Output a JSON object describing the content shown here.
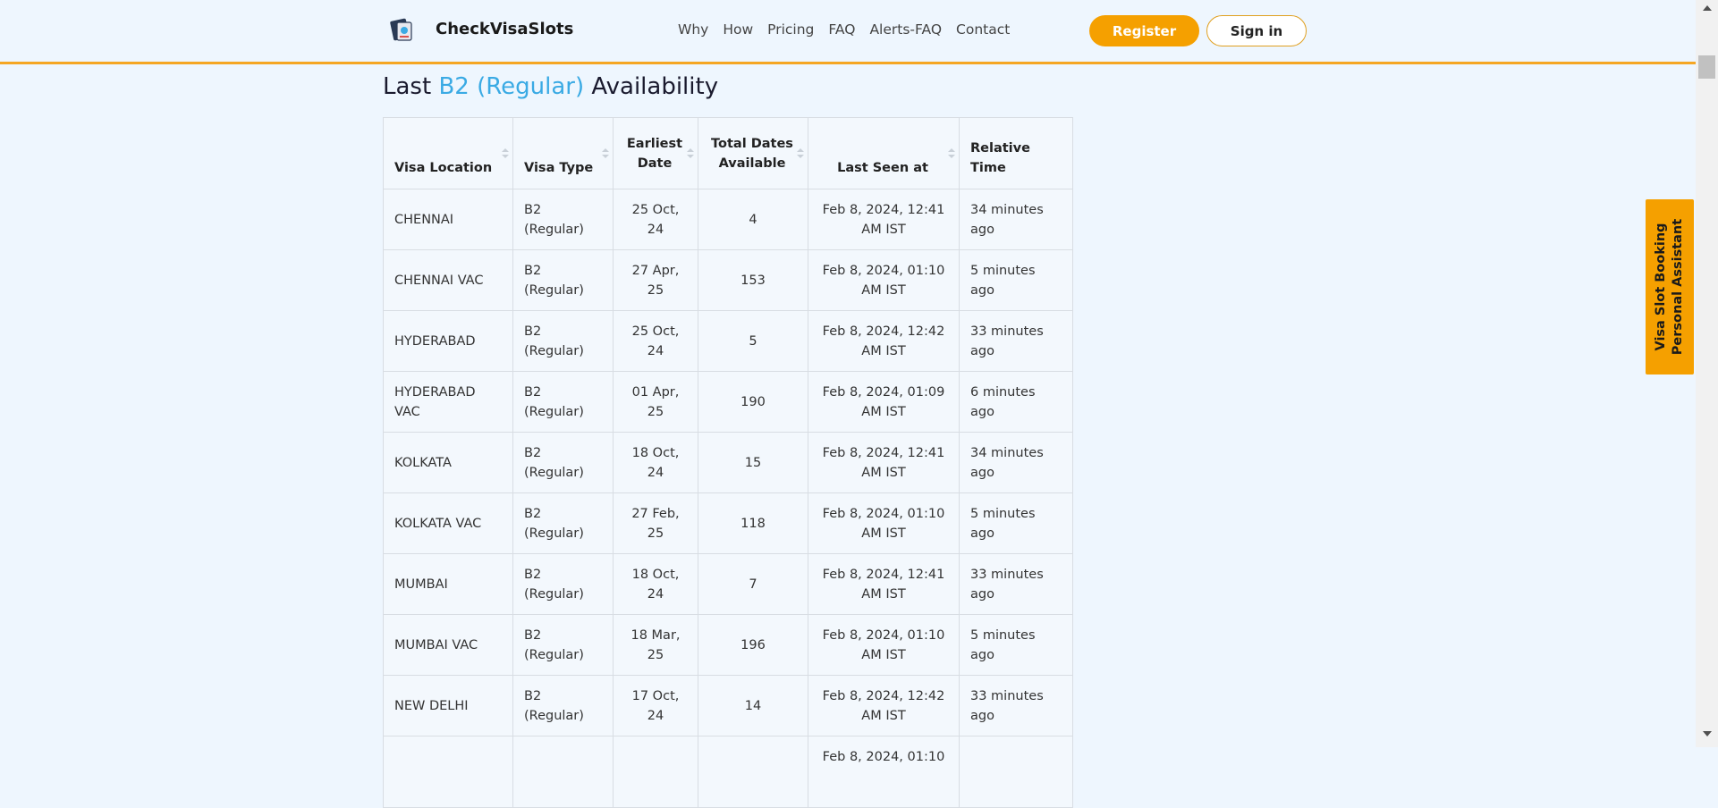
{
  "header": {
    "brand": "CheckVisaSlots",
    "nav": [
      "Why",
      "How",
      "Pricing",
      "FAQ",
      "Alerts-FAQ",
      "Contact"
    ],
    "register_label": "Register",
    "signin_label": "Sign in"
  },
  "title": {
    "prefix": "Last",
    "highlight": "B2 (Regular)",
    "suffix": "Availability"
  },
  "table": {
    "headers": [
      "Visa Location",
      "Visa Type",
      "Earliest Date",
      "Total Dates Available",
      "Last Seen at",
      "Relative Time"
    ],
    "rows": [
      [
        "CHENNAI",
        "B2 (Regular)",
        "25 Oct, 24",
        "4",
        "Feb 8, 2024, 12:41 AM IST",
        "34 minutes ago"
      ],
      [
        "CHENNAI VAC",
        "B2 (Regular)",
        "27 Apr, 25",
        "153",
        "Feb 8, 2024, 01:10 AM IST",
        "5 minutes ago"
      ],
      [
        "HYDERABAD",
        "B2 (Regular)",
        "25 Oct, 24",
        "5",
        "Feb 8, 2024, 12:42 AM IST",
        "33 minutes ago"
      ],
      [
        "HYDERABAD VAC",
        "B2 (Regular)",
        "01 Apr, 25",
        "190",
        "Feb 8, 2024, 01:09 AM IST",
        "6 minutes ago"
      ],
      [
        "KOLKATA",
        "B2 (Regular)",
        "18 Oct, 24",
        "15",
        "Feb 8, 2024, 12:41 AM IST",
        "34 minutes ago"
      ],
      [
        "KOLKATA VAC",
        "B2 (Regular)",
        "27 Feb, 25",
        "118",
        "Feb 8, 2024, 01:10 AM IST",
        "5 minutes ago"
      ],
      [
        "MUMBAI",
        "B2 (Regular)",
        "18 Oct, 24",
        "7",
        "Feb 8, 2024, 12:41 AM IST",
        "33 minutes ago"
      ],
      [
        "MUMBAI VAC",
        "B2 (Regular)",
        "18 Mar, 25",
        "196",
        "Feb 8, 2024, 01:10 AM IST",
        "5 minutes ago"
      ],
      [
        "NEW DELHI",
        "B2 (Regular)",
        "17 Oct, 24",
        "14",
        "Feb 8, 2024, 12:42 AM IST",
        "33 minutes ago"
      ],
      [
        "",
        "",
        "",
        "",
        "Feb 8, 2024, 01:10",
        ""
      ]
    ]
  },
  "side_tab": {
    "line1": "Visa Slot Booking",
    "line2": "Personal Assistant"
  },
  "colors": {
    "accent": "#f5a000",
    "highlight": "#3aaae4",
    "background": "#eef6fe"
  }
}
